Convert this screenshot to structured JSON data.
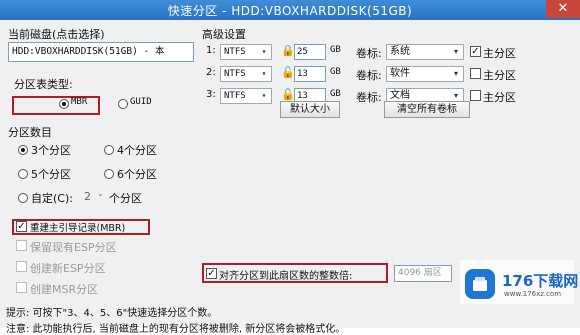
{
  "window": {
    "title": "快速分区 - HDD:VBOXHARDDISK(51GB)",
    "close": "✕"
  },
  "current_disk": {
    "label": "当前磁盘(点击选择)",
    "value": "HDD:VBOXHARDDISK(51GB) - 本"
  },
  "partition_table": {
    "label": "分区表类型:",
    "mbr": "MBR",
    "guid": "GUID",
    "selected": "MBR"
  },
  "partition_count": {
    "label": "分区数目",
    "options": [
      "3个分区",
      "4个分区",
      "5个分区",
      "6个分区"
    ],
    "selected": "3个分区",
    "custom_label": "自定(C):",
    "custom_value": "2",
    "custom_unit": "个分区"
  },
  "checks": {
    "rebuild_mbr": "重建主引导记录(MBR)",
    "keep_esp": "保留现有ESP分区",
    "create_esp": "创建新ESP分区",
    "create_msr": "创建MSR分区"
  },
  "advanced": {
    "label": "高级设置",
    "size_unit": "GB",
    "volume_label": "卷标:",
    "primary_label": "主分区",
    "rows": [
      {
        "index": "1:",
        "fs": "NTFS",
        "size": "25",
        "vol": "系统",
        "primary": true
      },
      {
        "index": "2:",
        "fs": "NTFS",
        "size": "13",
        "vol": "软件",
        "primary": false
      },
      {
        "index": "3:",
        "fs": "NTFS",
        "size": "13",
        "vol": "文档",
        "primary": false
      }
    ],
    "default_size_btn": "默认大小",
    "clear_labels_btn": "清空所有卷标"
  },
  "align": {
    "label": "对齐分区到此扇区数的整数倍:",
    "value": "4096 扇区"
  },
  "hints": {
    "line1": "提示: 可按下\"3、4、5、6\"快速选择分区个数。",
    "line2": "注意: 此功能执行后, 当前磁盘上的现有分区将被删除, 新分区将会被格式化。"
  },
  "watermark": {
    "brand": "176下载网",
    "url": "www.176xz.com"
  }
}
